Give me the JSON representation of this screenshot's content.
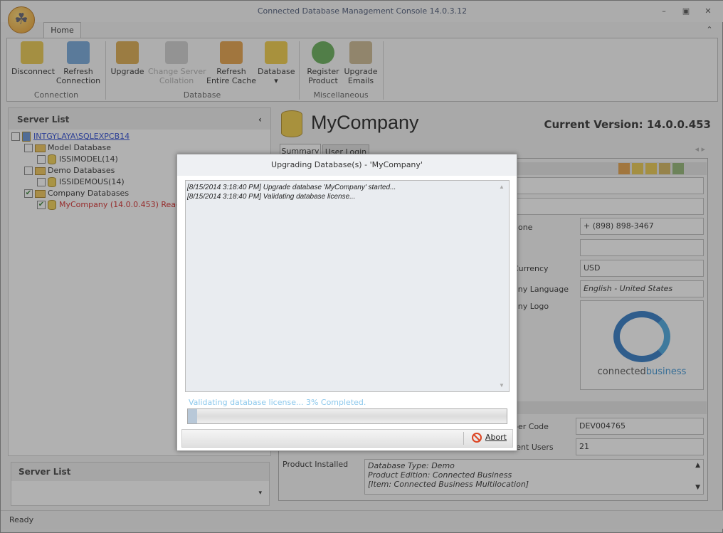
{
  "app": {
    "title": "Connected Database Management Console 14.0.3.12",
    "tab": "Home"
  },
  "ribbon": {
    "buttons": [
      {
        "label": "Disconnect"
      },
      {
        "label": "Refresh\nConnection"
      },
      {
        "label": "Upgrade"
      },
      {
        "label": "Change Server\nCollation"
      },
      {
        "label": "Refresh\nEntire Cache"
      },
      {
        "label": "Database"
      },
      {
        "label": "Register\nProduct"
      },
      {
        "label": "Upgrade\nEmails"
      }
    ],
    "groups": [
      "Connection",
      "Database",
      "Miscellaneous"
    ]
  },
  "server_list": {
    "title": "Server List",
    "bottom_title": "Server List",
    "items": [
      "INTGYLAYA\\SQLEXPCB14",
      "Model Database",
      "ISSIMODEL(14)",
      "Demo Databases",
      "ISSIDEMOUS(14)",
      "Company Databases",
      "MyCompany (14.0.0.453) Ready fo"
    ]
  },
  "main": {
    "company": "MyCompany",
    "version": "Current Version: 14.0.0.453",
    "tabs": [
      "Summary",
      "User Login"
    ],
    "labels": [
      "hone",
      "Currency",
      "any Language",
      "any Logo",
      "ber Code",
      "rent Users",
      "Product Installed"
    ],
    "phone": "+ (898) 898-3467",
    "currency": "USD",
    "language": "English - United States",
    "logo_text_a": "connected",
    "logo_text_b": "business",
    "dealer_code": "DEV004765",
    "users": "21",
    "product_installed": [
      "Database Type: Demo",
      "Product Edition: Connected Business",
      "[Item: Connected Business Multilocation]"
    ]
  },
  "dialog": {
    "title": "Upgrading Database(s) - 'MyCompany'",
    "log": [
      "[8/15/2014 3:18:40 PM] Upgrade database 'MyCompany' started...",
      "[8/15/2014 3:18:40 PM] Validating database license..."
    ],
    "progress_text": "Validating database license... 3% Completed.",
    "progress": 3,
    "abort": "Abort"
  },
  "status": "Ready"
}
